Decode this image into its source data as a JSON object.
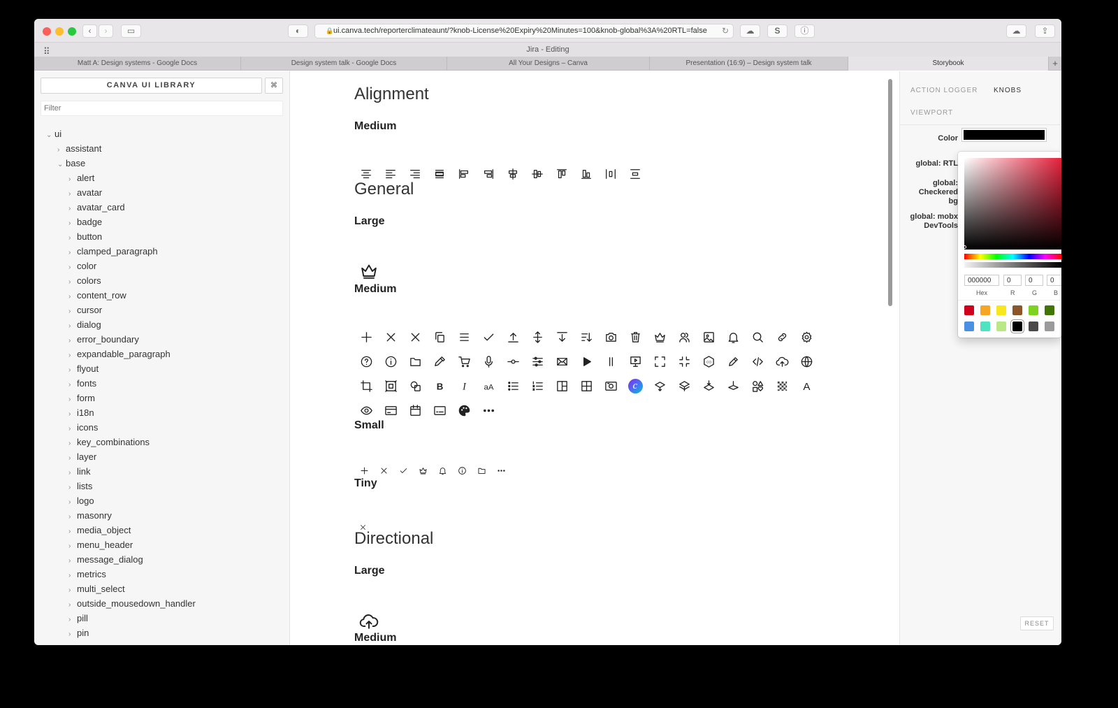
{
  "browser": {
    "url": "ui.canva.tech/reporterclimateaunt/?knob-License%20Expiry%20Minutes=100&knob-global%3A%20RTL=false",
    "window_title": "Jira - Editing",
    "tabs": [
      {
        "label": "Matt A: Design systems - Google Docs"
      },
      {
        "label": "Design system talk - Google Docs"
      },
      {
        "label": "All Your Designs – Canva"
      },
      {
        "label": "Presentation (16:9) – Design system talk"
      },
      {
        "label": "Storybook"
      }
    ],
    "new_tab": "+",
    "extension_label": "S"
  },
  "sidebar": {
    "library_title": "CANVA UI LIBRARY",
    "shortcut": "⌘",
    "filter_placeholder": "Filter",
    "tree": [
      {
        "label": "ui",
        "depth": 0,
        "expanded": true
      },
      {
        "label": "assistant",
        "depth": 1,
        "expanded": false
      },
      {
        "label": "base",
        "depth": 1,
        "expanded": true
      },
      {
        "label": "alert",
        "depth": 2,
        "expanded": false
      },
      {
        "label": "avatar",
        "depth": 2,
        "expanded": false
      },
      {
        "label": "avatar_card",
        "depth": 2,
        "expanded": false
      },
      {
        "label": "badge",
        "depth": 2,
        "expanded": false
      },
      {
        "label": "button",
        "depth": 2,
        "expanded": false
      },
      {
        "label": "clamped_paragraph",
        "depth": 2,
        "expanded": false
      },
      {
        "label": "color",
        "depth": 2,
        "expanded": false
      },
      {
        "label": "colors",
        "depth": 2,
        "expanded": false
      },
      {
        "label": "content_row",
        "depth": 2,
        "expanded": false
      },
      {
        "label": "cursor",
        "depth": 2,
        "expanded": false
      },
      {
        "label": "dialog",
        "depth": 2,
        "expanded": false
      },
      {
        "label": "error_boundary",
        "depth": 2,
        "expanded": false
      },
      {
        "label": "expandable_paragraph",
        "depth": 2,
        "expanded": false
      },
      {
        "label": "flyout",
        "depth": 2,
        "expanded": false
      },
      {
        "label": "fonts",
        "depth": 2,
        "expanded": false
      },
      {
        "label": "form",
        "depth": 2,
        "expanded": false
      },
      {
        "label": "i18n",
        "depth": 2,
        "expanded": false
      },
      {
        "label": "icons",
        "depth": 2,
        "expanded": false
      },
      {
        "label": "key_combinations",
        "depth": 2,
        "expanded": false
      },
      {
        "label": "layer",
        "depth": 2,
        "expanded": false
      },
      {
        "label": "link",
        "depth": 2,
        "expanded": false
      },
      {
        "label": "lists",
        "depth": 2,
        "expanded": false
      },
      {
        "label": "logo",
        "depth": 2,
        "expanded": false
      },
      {
        "label": "masonry",
        "depth": 2,
        "expanded": false
      },
      {
        "label": "media_object",
        "depth": 2,
        "expanded": false
      },
      {
        "label": "menu_header",
        "depth": 2,
        "expanded": false
      },
      {
        "label": "message_dialog",
        "depth": 2,
        "expanded": false
      },
      {
        "label": "metrics",
        "depth": 2,
        "expanded": false
      },
      {
        "label": "multi_select",
        "depth": 2,
        "expanded": false
      },
      {
        "label": "outside_mousedown_handler",
        "depth": 2,
        "expanded": false
      },
      {
        "label": "pill",
        "depth": 2,
        "expanded": false
      },
      {
        "label": "pin",
        "depth": 2,
        "expanded": false
      }
    ]
  },
  "main": {
    "sections": [
      {
        "title": "Alignment",
        "groups": [
          {
            "size": "Medium",
            "icons": [
              "align-center-icon",
              "align-left-icon",
              "align-right-icon",
              "align-justify-icon",
              "align-objects-left-icon",
              "align-objects-right-icon",
              "align-objects-center-icon",
              "align-objects-middle-icon",
              "align-objects-top-icon",
              "align-objects-bottom-icon",
              "distribute-horizontal-icon",
              "distribute-vertical-icon"
            ]
          }
        ]
      },
      {
        "title": "General",
        "groups": [
          {
            "size": "Large",
            "icons": [
              "crown-icon"
            ]
          },
          {
            "size": "Medium",
            "icons": [
              "plus-icon",
              "close-icon",
              "close-bold-icon",
              "copy-icon",
              "menu-icon",
              "check-icon",
              "arrow-up-to-line-icon",
              "arrows-vertical-icon",
              "arrow-down-to-line-icon",
              "sort-icon",
              "camera-icon",
              "trash-icon",
              "crown-icon",
              "users-icon",
              "image-icon",
              "bell-icon",
              "search-icon",
              "link-icon",
              "gear-icon",
              "help-icon",
              "info-icon",
              "folder-icon",
              "eyedropper-icon",
              "cart-icon",
              "microphone-icon",
              "commit-icon",
              "sliders-icon",
              "mail-icon",
              "play-icon",
              "pause-icon",
              "present-icon",
              "expand-icon",
              "collapse-icon",
              "co-badge-icon",
              "pencil-icon",
              "code-icon",
              "cloud-upload-icon",
              "globe-icon",
              "crop-icon",
              "frame-select-icon",
              "shapes-icon",
              "bold-icon",
              "italic-icon",
              "font-size-icon",
              "bullet-list-icon",
              "numbered-list-icon",
              "layout-icon",
              "grid-icon",
              "photo-card-icon",
              "canva-logo-icon",
              "layer-up-icon",
              "layers-stack-icon",
              "layers-down-icon",
              "layer-flat-icon",
              "elements-icon",
              "transparency-icon",
              "text-icon",
              "eye-icon",
              "credit-card-icon",
              "calendar-icon",
              "subtitles-icon",
              "palette-icon",
              "more-icon"
            ]
          },
          {
            "size": "Small",
            "icons": [
              "plus-icon",
              "close-icon",
              "check-icon",
              "crown-icon",
              "bell-icon",
              "info-icon",
              "folder-icon",
              "more-icon"
            ]
          },
          {
            "size": "Tiny",
            "icons": [
              "close-icon"
            ]
          }
        ]
      },
      {
        "title": "Directional",
        "groups": [
          {
            "size": "Large",
            "icons": [
              "cloud-upload-icon"
            ]
          },
          {
            "size": "Medium",
            "icons": []
          }
        ]
      }
    ],
    "glyph_text": {
      "bold": "B",
      "italic": "I",
      "font_size": "aA",
      "text": "A",
      "co": "CO"
    }
  },
  "panel": {
    "tabs": [
      {
        "label": "ACTION LOGGER",
        "active": false
      },
      {
        "label": "KNOBS",
        "active": true
      },
      {
        "label": "VIEWPORT",
        "active": false
      }
    ],
    "knobs": [
      {
        "label": "Color",
        "value": "#000000"
      },
      {
        "label": "global: RTL"
      },
      {
        "label": "global: Checkered bg"
      },
      {
        "label": "global: mobx DevTools"
      }
    ],
    "reset_label": "RESET"
  },
  "picker": {
    "hex": "000000",
    "r": "0",
    "g": "0",
    "b": "0",
    "labels": {
      "hex": "Hex",
      "r": "R",
      "g": "G",
      "b": "B"
    },
    "swatches": [
      "#d0021b",
      "#f5a623",
      "#f8e71c",
      "#8b572a",
      "#7ed321",
      "#417505",
      "#4a90e2",
      "#50e3c2",
      "#b8e986",
      "#000000",
      "#4a4a4a",
      "#9b9b9b"
    ]
  },
  "colors": {
    "accent": "#7d2ae8",
    "canva": "#4c6ef5"
  }
}
